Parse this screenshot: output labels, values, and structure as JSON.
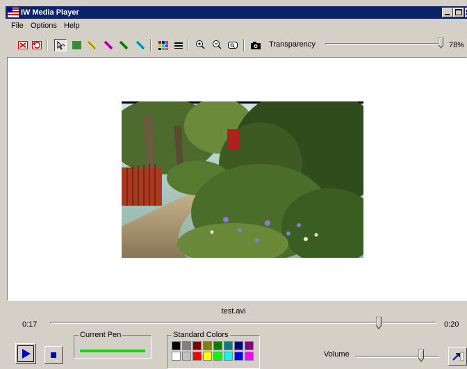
{
  "window": {
    "title": "IW Media Player"
  },
  "menu": {
    "items": [
      {
        "label": "File"
      },
      {
        "label": "Options"
      },
      {
        "label": "Help"
      }
    ]
  },
  "toolbar": {
    "icons": [
      {
        "name": "clear-icon",
        "color": "#cc0000"
      },
      {
        "name": "undo-icon",
        "color": "#cc0000"
      },
      {
        "name": "arrow-pointer-icon",
        "color": "#000000"
      },
      {
        "name": "rectangle-icon",
        "color": "#3a8a3a"
      },
      {
        "name": "pen-yellow-icon",
        "color": "#e8d800"
      },
      {
        "name": "pen-magenta-icon",
        "color": "#d000d0"
      },
      {
        "name": "pen-green-icon",
        "color": "#00a000"
      },
      {
        "name": "pen-cyan-icon",
        "color": "#00c0e0"
      },
      {
        "name": "color-grid-icon",
        "color": "#000000"
      },
      {
        "name": "line-width-icon",
        "color": "#000000"
      },
      {
        "name": "zoom-in-icon",
        "color": "#000000"
      },
      {
        "name": "zoom-out-icon",
        "color": "#000000"
      },
      {
        "name": "zoom-fit-icon",
        "color": "#000000"
      },
      {
        "name": "camera-icon",
        "color": "#000000"
      }
    ],
    "transparency_label": "Transparency",
    "transparency_value": 0.78,
    "transparency_text": "78%"
  },
  "video": {
    "filename": "test.avi"
  },
  "playback": {
    "current_time": "0:17",
    "total_time": "0:20",
    "progress": 0.85
  },
  "current_pen": {
    "label": "Current Pen",
    "color": "#00e000"
  },
  "standard_colors": {
    "label": "Standard Colors",
    "row1": [
      "#000000",
      "#808080",
      "#800000",
      "#808000",
      "#008000",
      "#008080",
      "#000080",
      "#800080"
    ],
    "row2": [
      "#ffffff",
      "#c0c0c0",
      "#ff0000",
      "#ffff00",
      "#00ff00",
      "#00ffff",
      "#0000ff",
      "#ff00ff"
    ]
  },
  "volume": {
    "label": "Volume",
    "level": 0.78
  }
}
